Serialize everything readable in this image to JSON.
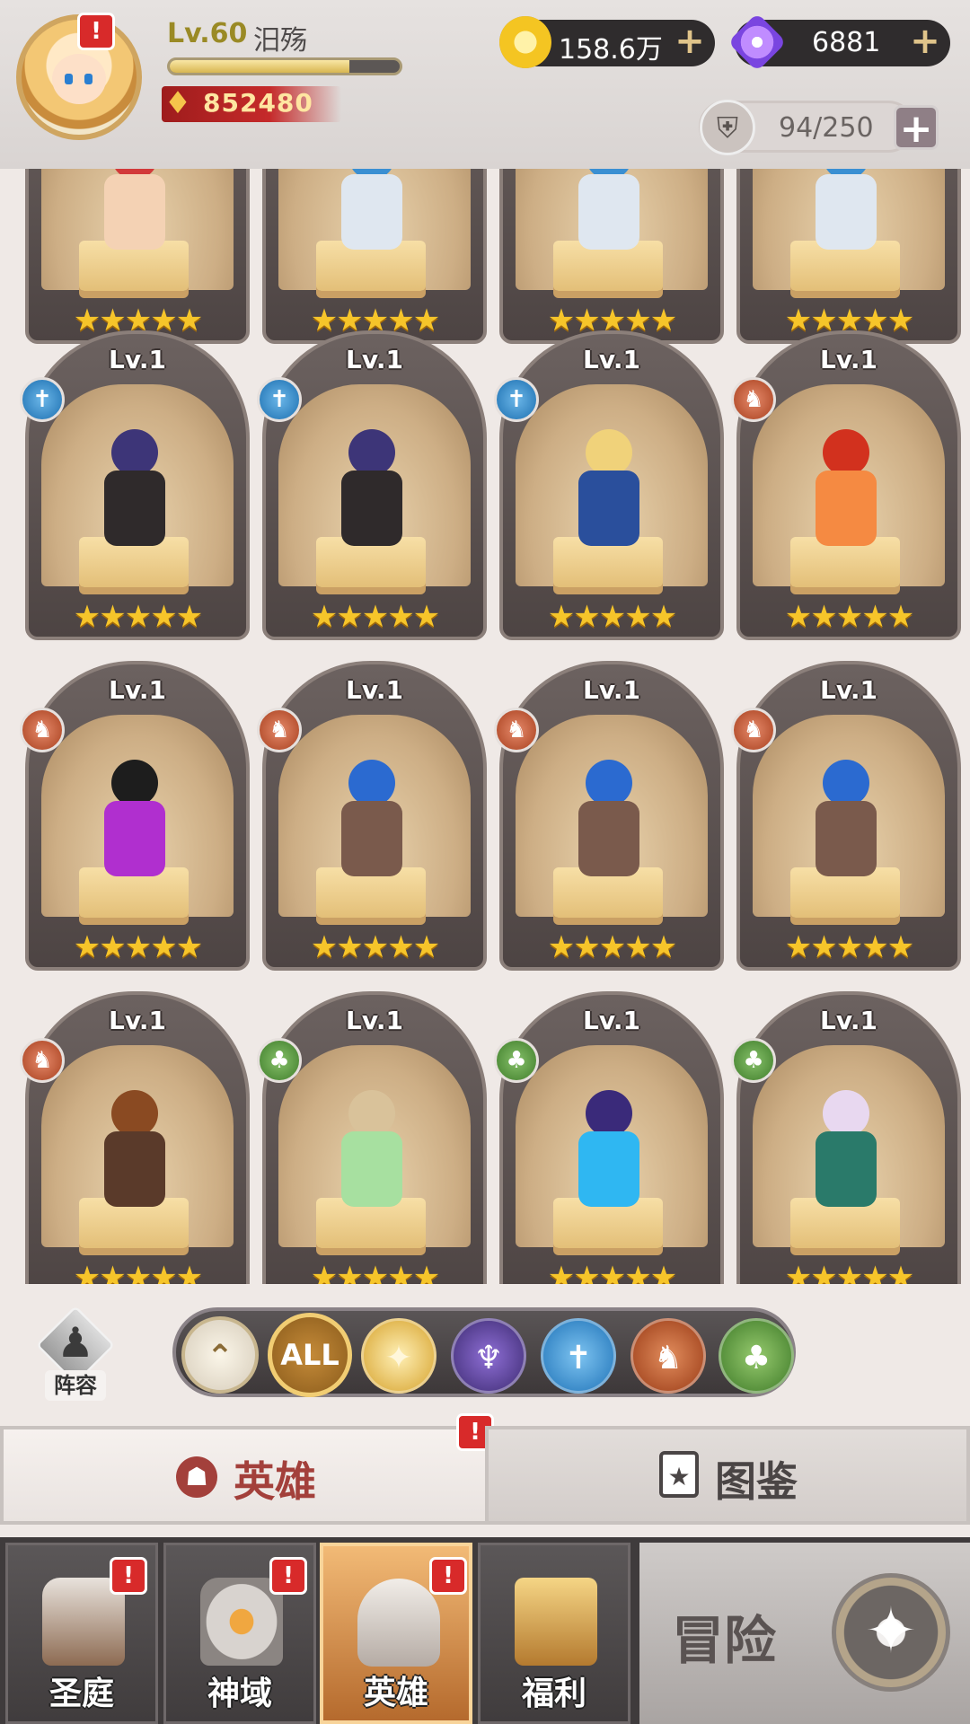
{
  "player": {
    "level": "Lv.60",
    "name": "汨殇",
    "exp_fraction": 0.78,
    "power": "852480"
  },
  "currency": {
    "gold": "158.6万",
    "gems": "6881",
    "plus": "+"
  },
  "heroes_capacity": "94/250",
  "alert_mark": "!",
  "grid": {
    "level_label": "Lv.1",
    "stars": "★★★★★",
    "rows": [
      [
        {
          "faction": "",
          "colors": [
            "#d23a3a",
            "#f4d2b4"
          ]
        },
        {
          "faction": "",
          "colors": [
            "#3a8fd2",
            "#dfe7f0"
          ]
        },
        {
          "faction": "",
          "colors": [
            "#3a8fd2",
            "#dfe7f0"
          ]
        },
        {
          "faction": "",
          "colors": [
            "#3a8fd2",
            "#dfe7f0"
          ]
        }
      ],
      [
        {
          "faction": "order",
          "colors": [
            "#3d3578",
            "#2f2a2b"
          ]
        },
        {
          "faction": "order",
          "colors": [
            "#3d3578",
            "#2f2a2b"
          ]
        },
        {
          "faction": "order",
          "colors": [
            "#f0d27a",
            "#2a4f9c"
          ]
        },
        {
          "faction": "beast",
          "colors": [
            "#d2311e",
            "#f58a42"
          ]
        }
      ],
      [
        {
          "faction": "beast",
          "colors": [
            "#1d1d1d",
            "#b02fcf"
          ]
        },
        {
          "faction": "beast",
          "colors": [
            "#2b6ad0",
            "#7a5a4c"
          ]
        },
        {
          "faction": "beast",
          "colors": [
            "#2b6ad0",
            "#7a5a4c"
          ]
        },
        {
          "faction": "beast",
          "colors": [
            "#2b6ad0",
            "#7a5a4c"
          ]
        }
      ],
      [
        {
          "faction": "beast",
          "colors": [
            "#8a4a22",
            "#5a3a2a"
          ]
        },
        {
          "faction": "nature",
          "colors": [
            "#d9c29a",
            "#a7e0a0"
          ]
        },
        {
          "faction": "nature",
          "colors": [
            "#3a2a7a",
            "#2fb7f2"
          ]
        },
        {
          "faction": "nature",
          "colors": [
            "#e8d8f0",
            "#2a7a6a"
          ]
        }
      ]
    ]
  },
  "filters": {
    "lineup_label": "阵容",
    "all_label": "ALL",
    "up_icon": "⌃",
    "light_icon": "✦",
    "dark_icon": "♆",
    "order_icon": "✝",
    "beast_icon": "♞",
    "nature_icon": "♣"
  },
  "tabs": {
    "hero": "英雄",
    "codex": "图鉴"
  },
  "nav": {
    "items": [
      "圣庭",
      "神域",
      "英雄",
      "福利"
    ],
    "adventure": "冒险"
  }
}
